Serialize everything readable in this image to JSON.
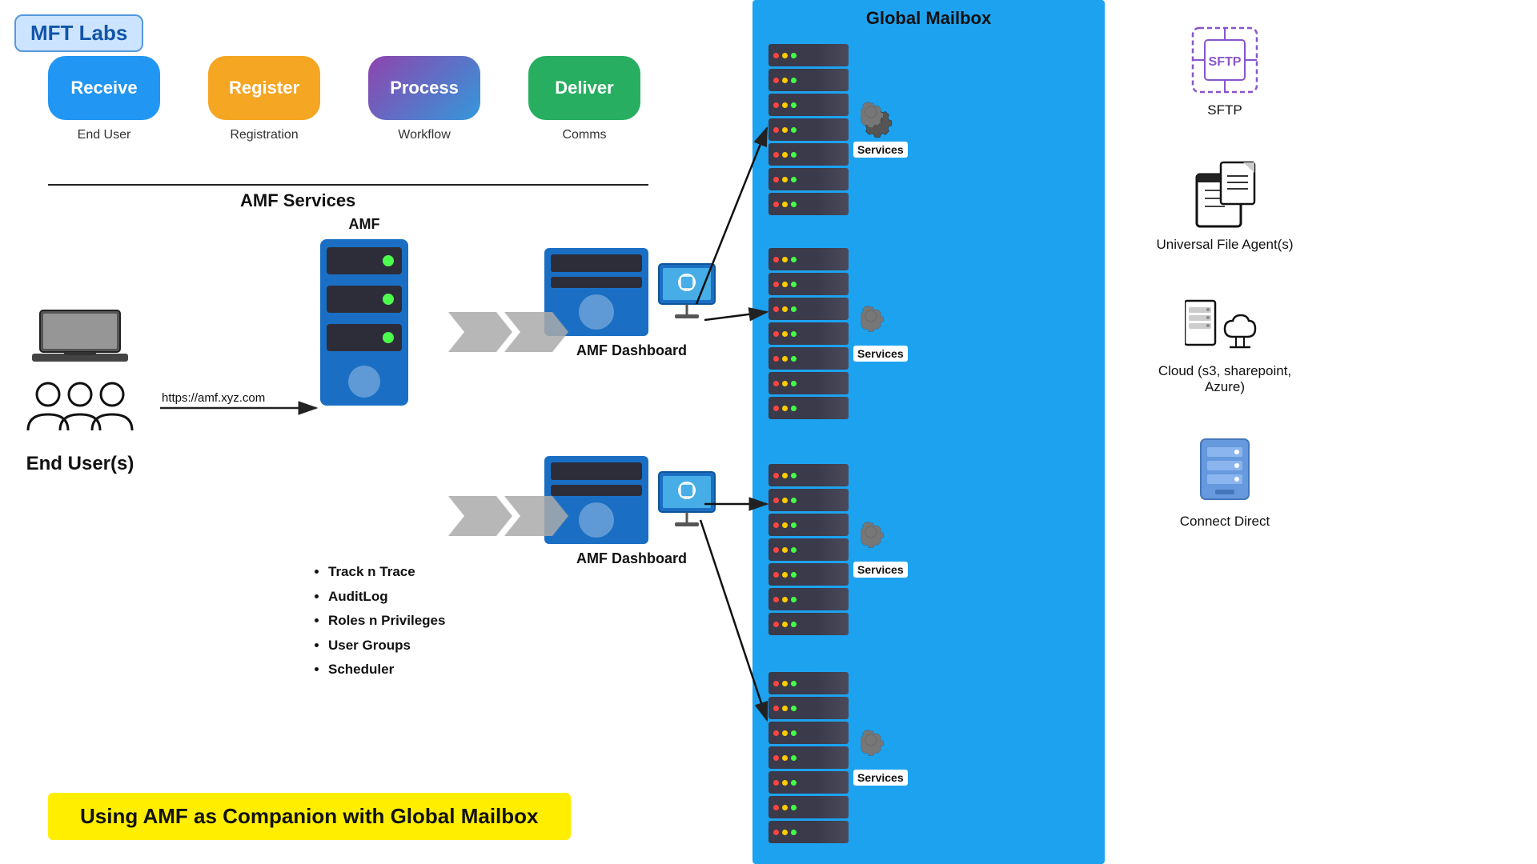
{
  "brand": {
    "name": "MFT Labs"
  },
  "top_flow": {
    "pills": [
      {
        "id": "receive",
        "label": "Receive",
        "sub": "End User",
        "color": "receive"
      },
      {
        "id": "register",
        "label": "Register",
        "sub": "Registration",
        "color": "register"
      },
      {
        "id": "process",
        "label": "Process",
        "sub": "Workflow",
        "color": "process"
      },
      {
        "id": "deliver",
        "label": "Deliver",
        "sub": "Comms",
        "color": "deliver"
      }
    ]
  },
  "amf_services_title": "AMF Services",
  "end_user": {
    "url": "https://amf.xyz.com",
    "label": "End User(s)"
  },
  "amf_server": {
    "label": "AMF"
  },
  "amf_features": [
    "Track n Trace",
    "AuditLog",
    "Roles n Privileges",
    "User Groups",
    "Scheduler"
  ],
  "dashboards": [
    {
      "label": "AMF Dashboard"
    },
    {
      "label": "AMF Dashboard"
    }
  ],
  "global_mailbox": {
    "title": "Global Mailbox",
    "services_label": "Services"
  },
  "right_icons": [
    {
      "id": "sftp",
      "label": "SFTP"
    },
    {
      "id": "ufa",
      "label": "Universal File Agent(s)"
    },
    {
      "id": "cloud",
      "label": "Cloud (s3, sharepoint, Azure)"
    },
    {
      "id": "connect-direct",
      "label": "Connect Direct"
    }
  ],
  "bottom_banner": "Using AMF as Companion with Global Mailbox"
}
